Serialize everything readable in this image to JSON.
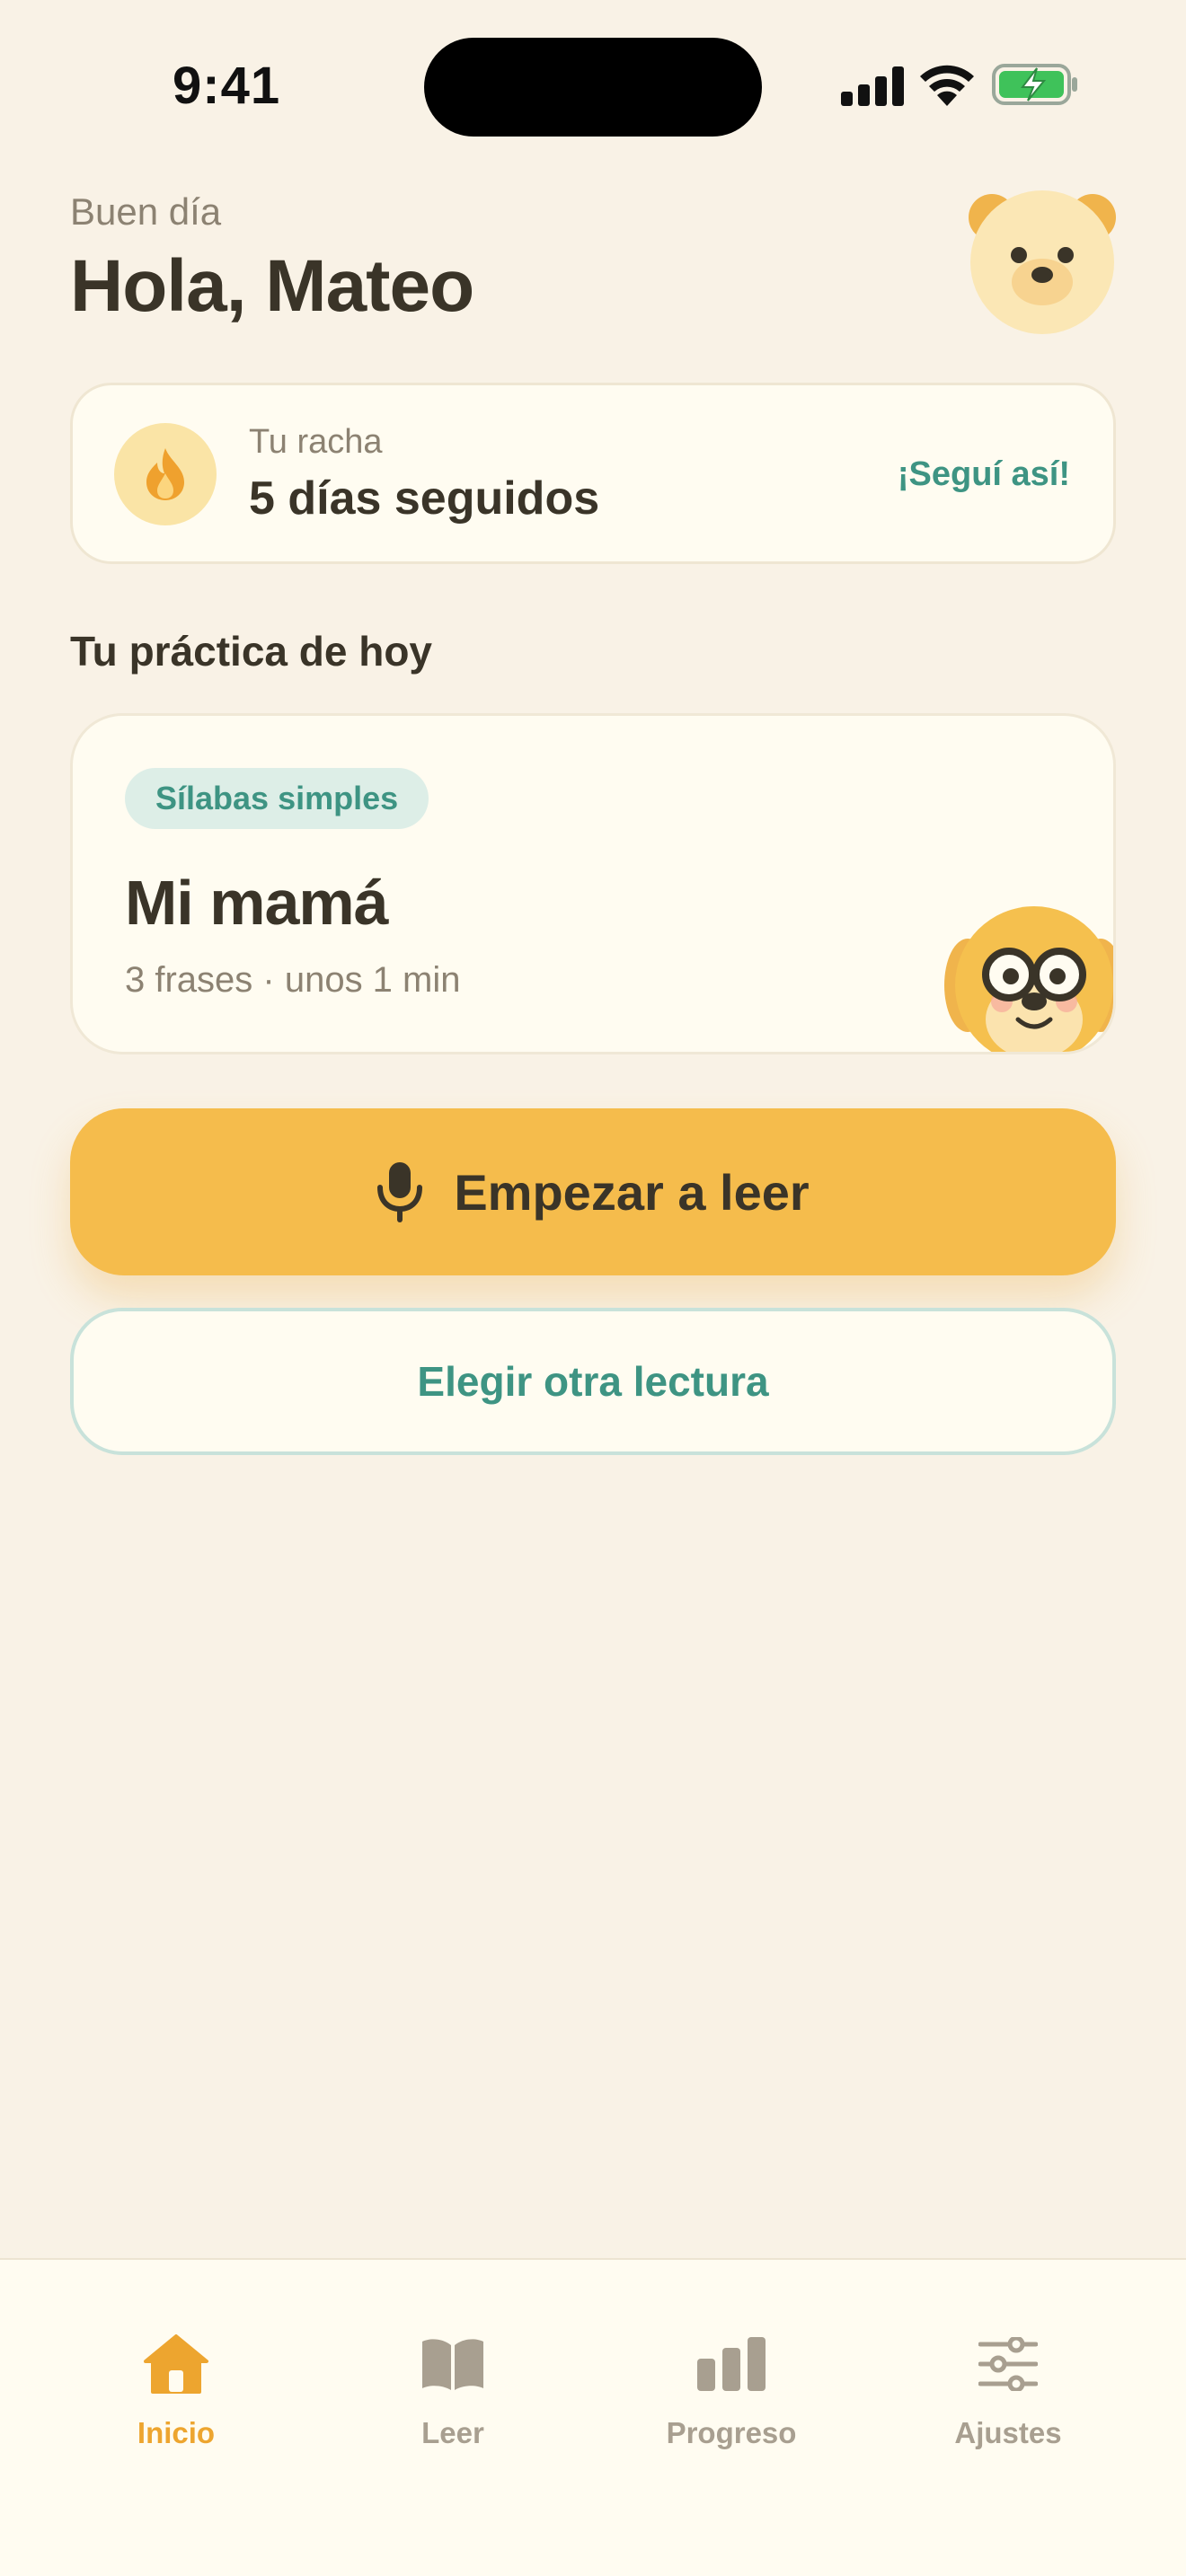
{
  "status_bar": {
    "time": "9:41",
    "icons": [
      "cellular-signal-icon",
      "wifi-icon",
      "battery-charging-icon"
    ]
  },
  "header": {
    "greeting": "Buen día",
    "title": "Hola, Mateo",
    "avatar_icon": "bear-avatar-icon"
  },
  "streak": {
    "icon": "flame-icon",
    "label": "Tu racha",
    "value": "5 días seguidos",
    "cheer": "¡Seguí así!"
  },
  "practice": {
    "section_title": "Tu práctica de hoy",
    "tag": "Sílabas simples",
    "title": "Mi mamá",
    "meta": "3 frases · unos 1 min",
    "mascot_icon": "dog-with-glasses-mascot-icon"
  },
  "actions": {
    "primary_label": "Empezar a leer",
    "primary_icon": "microphone-icon",
    "secondary_label": "Elegir otra lectura"
  },
  "tab_bar": {
    "tabs": [
      {
        "label": "Inicio",
        "icon": "home-icon",
        "active": true
      },
      {
        "label": "Leer",
        "icon": "book-icon",
        "active": false
      },
      {
        "label": "Progreso",
        "icon": "bar-chart-icon",
        "active": false
      },
      {
        "label": "Ajustes",
        "icon": "sliders-icon",
        "active": false
      }
    ]
  },
  "colors": {
    "background": "#F9F2E6",
    "card": "#FFFCF1",
    "accent_yellow": "#F5BC4C",
    "accent_teal": "#3E9483",
    "text_dark": "#3A3428",
    "text_muted": "#8C8272",
    "tab_active": "#EDA52F",
    "tab_inactive": "#A89F90"
  }
}
